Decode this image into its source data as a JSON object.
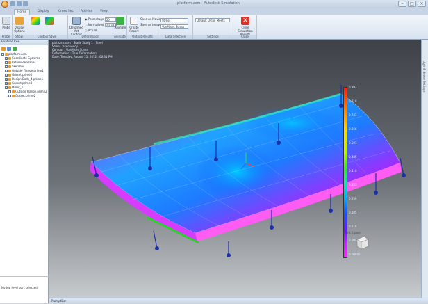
{
  "window": {
    "title": "platform.asm - Autodesk Simulation"
  },
  "tabs": [
    "Home",
    "Display",
    "Cross Sec",
    "Add-Ins",
    "View"
  ],
  "ribbon": {
    "groups": [
      {
        "label": "Probe",
        "buttons": [
          "Probe"
        ]
      },
      {
        "label": "Show",
        "buttons": [
          "Display Options"
        ]
      },
      {
        "label": "Contour Style",
        "buttons": [
          "Deformed"
        ]
      },
      {
        "label": "Deformation",
        "buttons": [
          "Deformed Act Contour"
        ],
        "rows": [
          "Percentage",
          "Normalized",
          "Actual"
        ],
        "value": "50",
        "value2": "2.938 in"
      },
      {
        "label": "Animate",
        "buttons": [
          "Animate"
        ]
      },
      {
        "label": "Output Results",
        "buttons": [
          "Create Report"
        ],
        "rows": [
          "Save As Movie",
          "Save As Image"
        ]
      },
      {
        "label": "Data Selection",
        "rows": [
          "Stress",
          "VonMises Stress"
        ]
      },
      {
        "label": "Settings",
        "rows": [
          "Default Dylan Meets"
        ]
      },
      {
        "label": "Close",
        "buttons": [
          "Close Simulation Results"
        ]
      }
    ]
  },
  "feature_tree": {
    "title": "FeatureTree",
    "items": [
      {
        "label": "platform.asm",
        "checked": false,
        "indent": 0
      },
      {
        "label": "Coordinate Systems",
        "checked": true,
        "indent": 1
      },
      {
        "label": "Reference Planes",
        "checked": false,
        "indent": 1
      },
      {
        "label": "Sketches",
        "checked": false,
        "indent": 1
      },
      {
        "label": "Outside Flange.prime1",
        "checked": true,
        "indent": 1
      },
      {
        "label": "Gusset.prime1",
        "checked": true,
        "indent": 1
      },
      {
        "label": "Design Body_4.prime1",
        "checked": true,
        "indent": 1
      },
      {
        "label": "Gusset.prime3",
        "checked": true,
        "indent": 1
      },
      {
        "label": "Mirror_1",
        "checked": true,
        "indent": 1
      },
      {
        "label": "Outside Flange.prime2",
        "checked": true,
        "indent": 2
      },
      {
        "label": "Gusset.prime2",
        "checked": true,
        "indent": 2
      }
    ],
    "status": "No top level part selected."
  },
  "viewport_info": [
    "platform.asm : Static Study 1 : Steel",
    "Stress : Frequency",
    "Contour : VonMises Stress",
    "Deformation : True Deformation",
    "Date: Tuesday, August 21, 2012 : 06:31 PM"
  ],
  "legend": {
    "values": [
      "0.893",
      "0.810",
      "0.741",
      "0.666",
      "0.591",
      "0.485",
      "0.410",
      "0.335",
      "0.259",
      "0.185",
      "0.110",
      "0.0041",
      "0.00045"
    ],
    "colors": {
      "high": "#ff1c0a",
      "mid": "#33e233",
      "low": "#ff29ff"
    }
  },
  "view_cube_label": "Right, Upper",
  "status_bar": "PromptBar",
  "right_panel_label": "Light & Scene Settings"
}
